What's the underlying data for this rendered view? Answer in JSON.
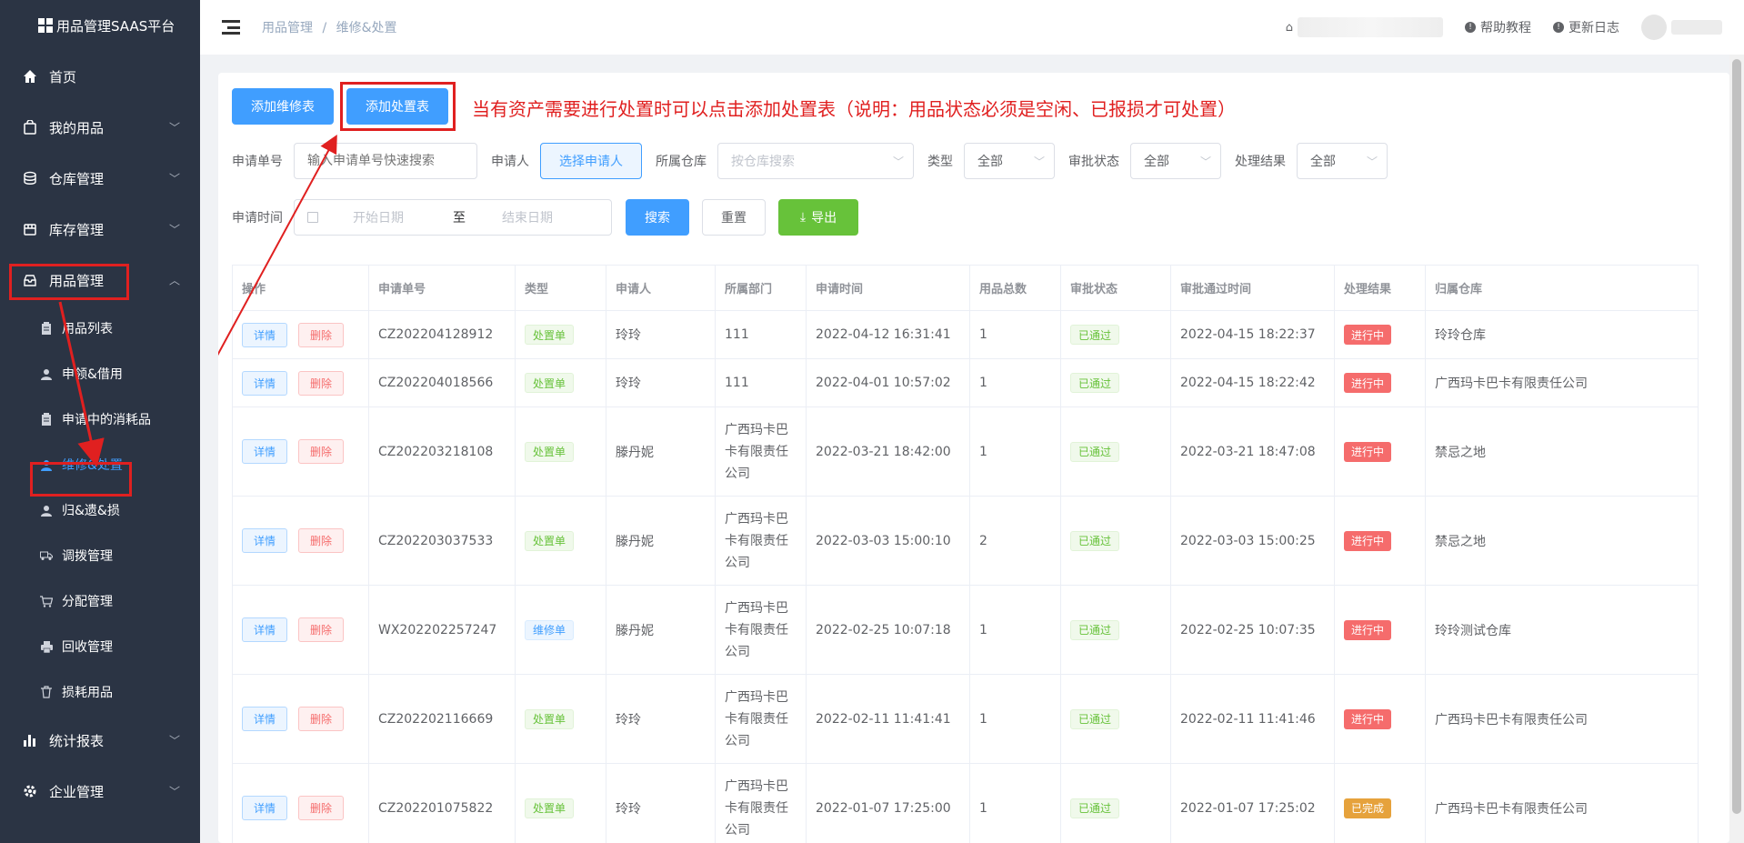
{
  "sidebar": {
    "logo": "用品管理SAAS平台",
    "items": [
      {
        "label": "首页",
        "icon": "home-icon"
      },
      {
        "label": "我的用品",
        "icon": "bag-icon"
      },
      {
        "label": "仓库管理",
        "icon": "database-icon"
      },
      {
        "label": "库存管理",
        "icon": "box-icon"
      },
      {
        "label": "用品管理",
        "icon": "inbox-icon"
      }
    ],
    "sub_items": [
      {
        "label": "用品列表",
        "icon": "clipboard-icon"
      },
      {
        "label": "申领&借用",
        "icon": "user-icon"
      },
      {
        "label": "申请中的消耗品",
        "icon": "clipboard-icon"
      },
      {
        "label": "维修&处置",
        "icon": "user-icon"
      },
      {
        "label": "归&遗&损",
        "icon": "user-icon"
      },
      {
        "label": "调拨管理",
        "icon": "truck-icon"
      },
      {
        "label": "分配管理",
        "icon": "cart-icon"
      },
      {
        "label": "回收管理",
        "icon": "printer-icon"
      },
      {
        "label": "损耗用品",
        "icon": "trash-icon"
      }
    ],
    "bottom_items": [
      {
        "label": "统计报表",
        "icon": "bar-chart-icon"
      },
      {
        "label": "企业管理",
        "icon": "gear-icon"
      }
    ]
  },
  "header": {
    "breadcrumb_parent": "用品管理",
    "breadcrumb_sep": "/",
    "breadcrumb_current": "维修&处置",
    "help_label": "帮助教程",
    "changelog_label": "更新日志"
  },
  "toolbar": {
    "add_repair_label": "添加维修表",
    "add_disposal_label": "添加处置表",
    "annotation": "当有资产需要进行处置时可以点击添加处置表（说明：用品状态必须是空闲、已报损才可处置）"
  },
  "filters": {
    "order_no_label": "申请单号",
    "order_no_placeholder": "输入申请单号快速搜索",
    "applicant_label": "申请人",
    "applicant_button": "选择申请人",
    "warehouse_label": "所属仓库",
    "warehouse_placeholder": "按仓库搜索",
    "type_label": "类型",
    "type_value": "全部",
    "approval_label": "审批状态",
    "approval_value": "全部",
    "result_label": "处理结果",
    "result_value": "全部",
    "time_label": "申请时间",
    "start_placeholder": "开始日期",
    "range_sep": "至",
    "end_placeholder": "结束日期",
    "search_label": "搜索",
    "reset_label": "重置",
    "export_label": "导出"
  },
  "table": {
    "columns": [
      "操作",
      "申请单号",
      "类型",
      "申请人",
      "所属部门",
      "申请时间",
      "用品总数",
      "审批状态",
      "审批通过时间",
      "处理结果",
      "归属仓库"
    ],
    "detail_label": "详情",
    "delete_label": "删除",
    "rows": [
      {
        "no": "CZ202204128912",
        "type": "处置单",
        "type_color": "green",
        "applicant": "玲玲",
        "dept": "111",
        "time": "2022-04-12 16:31:41",
        "count": "1",
        "approval": "已通过",
        "approved_time": "2022-04-15 18:22:37",
        "result": "进行中",
        "result_color": "red",
        "warehouse": "玲玲仓库"
      },
      {
        "no": "CZ202204018566",
        "type": "处置单",
        "type_color": "green",
        "applicant": "玲玲",
        "dept": "111",
        "time": "2022-04-01 10:57:02",
        "count": "1",
        "approval": "已通过",
        "approved_time": "2022-04-15 18:22:42",
        "result": "进行中",
        "result_color": "red",
        "warehouse": "广西玛卡巴卡有限责任公司"
      },
      {
        "no": "CZ202203218108",
        "type": "处置单",
        "type_color": "green",
        "applicant": "滕丹妮",
        "dept": "广西玛卡巴卡有限责任公司",
        "time": "2022-03-21 18:42:00",
        "count": "1",
        "approval": "已通过",
        "approved_time": "2022-03-21 18:47:08",
        "result": "进行中",
        "result_color": "red",
        "warehouse": "禁忌之地"
      },
      {
        "no": "CZ202203037533",
        "type": "处置单",
        "type_color": "green",
        "applicant": "滕丹妮",
        "dept": "广西玛卡巴卡有限责任公司",
        "time": "2022-03-03 15:00:10",
        "count": "2",
        "approval": "已通过",
        "approved_time": "2022-03-03 15:00:25",
        "result": "进行中",
        "result_color": "red",
        "warehouse": "禁忌之地"
      },
      {
        "no": "WX202202257247",
        "type": "维修单",
        "type_color": "blue",
        "applicant": "滕丹妮",
        "dept": "广西玛卡巴卡有限责任公司",
        "time": "2022-02-25 10:07:18",
        "count": "1",
        "approval": "已通过",
        "approved_time": "2022-02-25 10:07:35",
        "result": "进行中",
        "result_color": "red",
        "warehouse": "玲玲测试仓库"
      },
      {
        "no": "CZ202202116669",
        "type": "处置单",
        "type_color": "green",
        "applicant": "玲玲",
        "dept": "广西玛卡巴卡有限责任公司",
        "time": "2022-02-11 11:41:41",
        "count": "1",
        "approval": "已通过",
        "approved_time": "2022-02-11 11:41:46",
        "result": "进行中",
        "result_color": "red",
        "warehouse": "广西玛卡巴卡有限责任公司"
      },
      {
        "no": "CZ202201075822",
        "type": "处置单",
        "type_color": "green",
        "applicant": "玲玲",
        "dept": "广西玛卡巴卡有限责任公司",
        "time": "2022-01-07 17:25:00",
        "count": "1",
        "approval": "已通过",
        "approved_time": "2022-01-07 17:25:02",
        "result": "已完成",
        "result_color": "orange",
        "warehouse": "广西玛卡巴卡有限责任公司"
      }
    ]
  },
  "colors": {
    "sidebar_bg": "#2b3444",
    "primary": "#409eff",
    "success": "#67c23a",
    "danger": "#f56c6c",
    "warning": "#e6a23c",
    "annotation": "#e02020"
  }
}
